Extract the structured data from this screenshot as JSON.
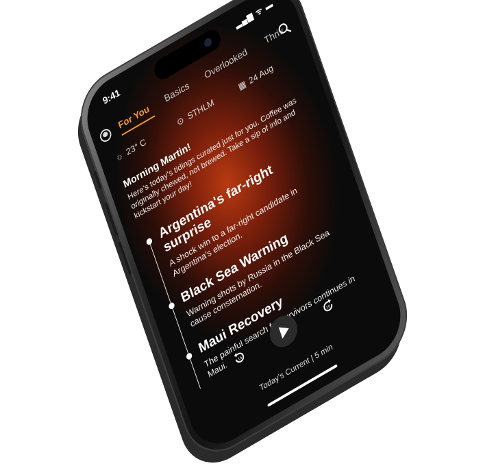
{
  "status": {
    "time": "9:41",
    "icons": "▂▄▆ ᯤ ▬"
  },
  "tabs": [
    {
      "label": "For You",
      "active": true
    },
    {
      "label": "Basics",
      "active": false
    },
    {
      "label": "Overlooked",
      "active": false
    },
    {
      "label": "Thriv",
      "active": false
    }
  ],
  "meta": {
    "weather": "23° C",
    "location": "STHLM",
    "date": "24 Aug"
  },
  "greeting": {
    "title": "Morning Martin!",
    "body": "Here's today's tidings curated just for you. Coffee was originally chewed, not brewed. Take a sip of info and kickstart your day!"
  },
  "stories": [
    {
      "title": "Argentina's far-right surprise",
      "summary": "A shock win to a far-right candidate in Argentina's election."
    },
    {
      "title": "Black Sea Warning",
      "summary": "Warning shots by Russia in the Black Sea cause consternation."
    },
    {
      "title": "Maui Recovery",
      "summary": "The painful search for survivors continues in Maui."
    }
  ],
  "player": {
    "now_playing": "Today's Current | 5 min",
    "skip_back": "15",
    "skip_forward": "15"
  },
  "colors": {
    "accent": "#f19a2d",
    "background": "#0b0b0b",
    "glow": "#b93a10"
  }
}
